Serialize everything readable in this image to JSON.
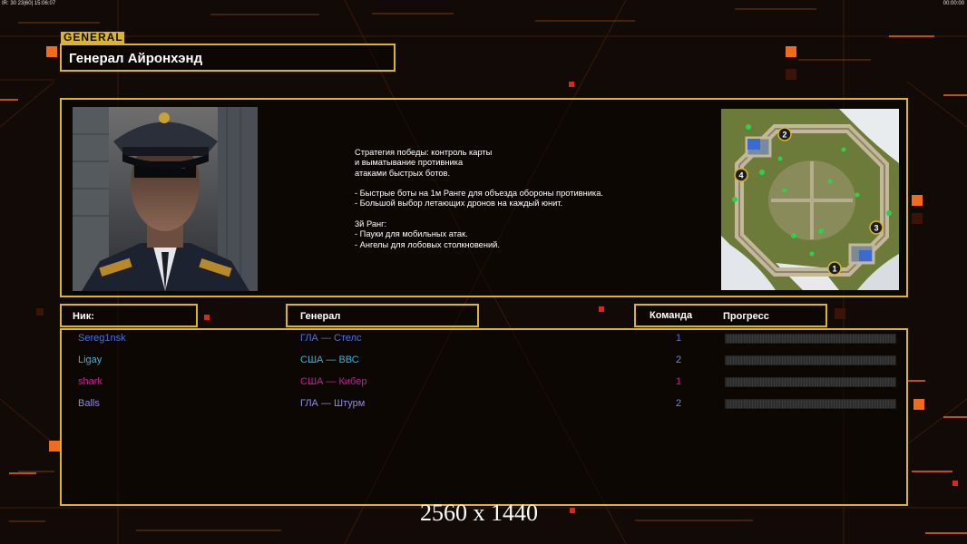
{
  "debug": {
    "left": "IR: 30 23|60| 15:06:07",
    "right": "00:00:00"
  },
  "general": {
    "tag": "GENERAL",
    "name": "Генерал Айронхэнд"
  },
  "description": "Стратегия победы: контроль карты\nи выматывание противника\nатаками быстрых ботов.\n\n- Быстрые боты на 1м Ранге для объезда обороны противника.\n- Большой выбор летающих дронов на каждый юнит.\n\n3й Ранг:\n- Пауки для мобильных атак.\n- Ангелы для лобовых столкновений.",
  "map": {
    "markers": [
      "1",
      "2",
      "3",
      "4"
    ]
  },
  "table": {
    "headers": {
      "nick": "Ник:",
      "general": "Генерал",
      "team": "Команда",
      "progress": "Прогресс"
    },
    "rows": [
      {
        "nick": "Sereg1nsk",
        "general": "ГЛА — Стелс",
        "team": "1",
        "color": "#4b6fe0",
        "team_color": "#4b6fe0"
      },
      {
        "nick": "Ligay",
        "general": "США — ВВС",
        "team": "2",
        "color": "#2fb6e6",
        "team_color": "#7a86e6"
      },
      {
        "nick": "shark",
        "general": "США — Кибер",
        "team": "1",
        "color": "#c91f96",
        "team_color": "#c91f96"
      },
      {
        "nick": "Balls",
        "general": "ГЛА — Штурм",
        "team": "2",
        "color": "#8d8ae8",
        "team_color": "#7a86e6"
      }
    ]
  },
  "resolution": "2560 x 1440",
  "colors": {
    "accent": "#d9b52a",
    "orange": "#f26a1b",
    "background": "#120a06"
  }
}
